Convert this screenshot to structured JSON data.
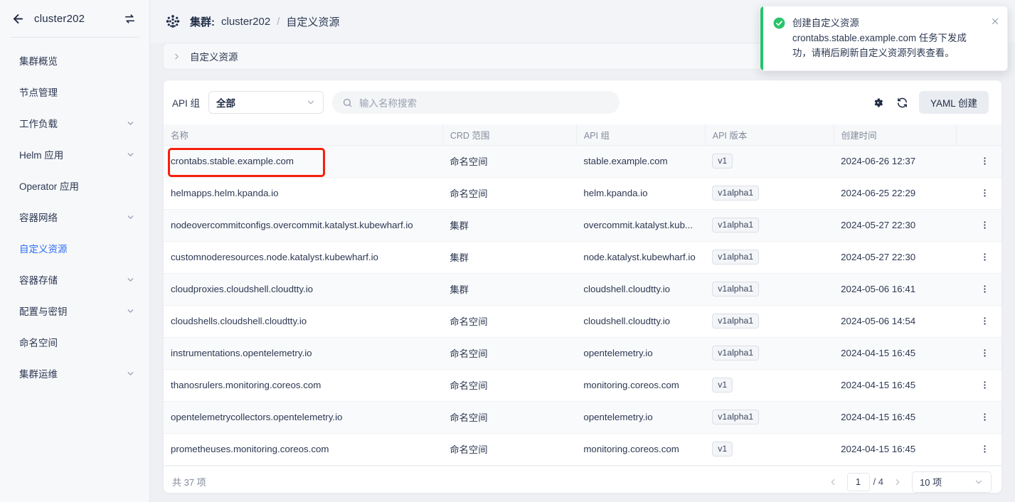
{
  "sidebar": {
    "back_icon": "arrow-left-icon",
    "cluster_name": "cluster202",
    "swap_icon": "swap-cluster-icon",
    "items": [
      {
        "label": "集群概览",
        "expandable": false,
        "active": false
      },
      {
        "label": "节点管理",
        "expandable": false,
        "active": false
      },
      {
        "label": "工作负载",
        "expandable": true,
        "active": false
      },
      {
        "label": "Helm 应用",
        "expandable": true,
        "active": false
      },
      {
        "label": "Operator 应用",
        "expandable": false,
        "active": false
      },
      {
        "label": "容器网络",
        "expandable": true,
        "active": false
      },
      {
        "label": "自定义资源",
        "expandable": false,
        "active": true
      },
      {
        "label": "容器存储",
        "expandable": true,
        "active": false
      },
      {
        "label": "配置与密钥",
        "expandable": true,
        "active": false
      },
      {
        "label": "命名空间",
        "expandable": false,
        "active": false
      },
      {
        "label": "集群运维",
        "expandable": true,
        "active": false
      }
    ]
  },
  "header": {
    "logo_icon": "cluster-dots-icon",
    "crumb_key": "集群:",
    "crumb_cluster": "cluster202",
    "crumb_sep": "/",
    "crumb_page": "自定义资源"
  },
  "contextbar": {
    "chevron_icon": "chevron-right-icon",
    "text": "自定义资源",
    "close_icon": "close-icon"
  },
  "toolbar": {
    "api_group_label": "API 组",
    "api_group_value": "全部",
    "search_icon": "search-icon",
    "search_placeholder": "输入名称搜索",
    "search_value": "",
    "settings_icon": "gear-icon",
    "refresh_icon": "refresh-icon",
    "create_label": "YAML 创建"
  },
  "table": {
    "columns": [
      "名称",
      "CRD 范围",
      "API 组",
      "API 版本",
      "创建时间",
      ""
    ],
    "rows": [
      {
        "name": "crontabs.stable.example.com",
        "scope": "命名空间",
        "group": "stable.example.com",
        "version": "v1",
        "created": "2024-06-26 12:37",
        "highlighted": true
      },
      {
        "name": "helmapps.helm.kpanda.io",
        "scope": "命名空间",
        "group": "helm.kpanda.io",
        "version": "v1alpha1",
        "created": "2024-06-25 22:29",
        "highlighted": false
      },
      {
        "name": "nodeovercommitconfigs.overcommit.katalyst.kubewharf.io",
        "scope": "集群",
        "group": "overcommit.katalyst.kub...",
        "version": "v1alpha1",
        "created": "2024-05-27 22:30",
        "highlighted": false
      },
      {
        "name": "customnoderesources.node.katalyst.kubewharf.io",
        "scope": "集群",
        "group": "node.katalyst.kubewharf.io",
        "version": "v1alpha1",
        "created": "2024-05-27 22:30",
        "highlighted": false
      },
      {
        "name": "cloudproxies.cloudshell.cloudtty.io",
        "scope": "集群",
        "group": "cloudshell.cloudtty.io",
        "version": "v1alpha1",
        "created": "2024-05-06 16:41",
        "highlighted": false
      },
      {
        "name": "cloudshells.cloudshell.cloudtty.io",
        "scope": "命名空间",
        "group": "cloudshell.cloudtty.io",
        "version": "v1alpha1",
        "created": "2024-05-06 14:54",
        "highlighted": false
      },
      {
        "name": "instrumentations.opentelemetry.io",
        "scope": "命名空间",
        "group": "opentelemetry.io",
        "version": "v1alpha1",
        "created": "2024-04-15 16:45",
        "highlighted": false
      },
      {
        "name": "thanosrulers.monitoring.coreos.com",
        "scope": "命名空间",
        "group": "monitoring.coreos.com",
        "version": "v1",
        "created": "2024-04-15 16:45",
        "highlighted": false
      },
      {
        "name": "opentelemetrycollectors.opentelemetry.io",
        "scope": "命名空间",
        "group": "opentelemetry.io",
        "version": "v1alpha1",
        "created": "2024-04-15 16:45",
        "highlighted": false
      },
      {
        "name": "prometheuses.monitoring.coreos.com",
        "scope": "命名空间",
        "group": "monitoring.coreos.com",
        "version": "v1",
        "created": "2024-04-15 16:45",
        "highlighted": false
      }
    ],
    "row_action_icon": "kebab-menu-icon"
  },
  "footer": {
    "total_text": "共 37 项",
    "prev_icon": "chevron-left-icon",
    "next_icon": "chevron-right-icon",
    "current_page": "1",
    "page_total": "/ 4",
    "page_size": "10 项"
  },
  "toast": {
    "status_icon": "success-check-icon",
    "message": "创建自定义资源 crontabs.stable.example.com 任务下发成功，请稍后刷新自定义资源列表查看。",
    "close_icon": "close-icon",
    "accent_color": "#27c46a"
  }
}
